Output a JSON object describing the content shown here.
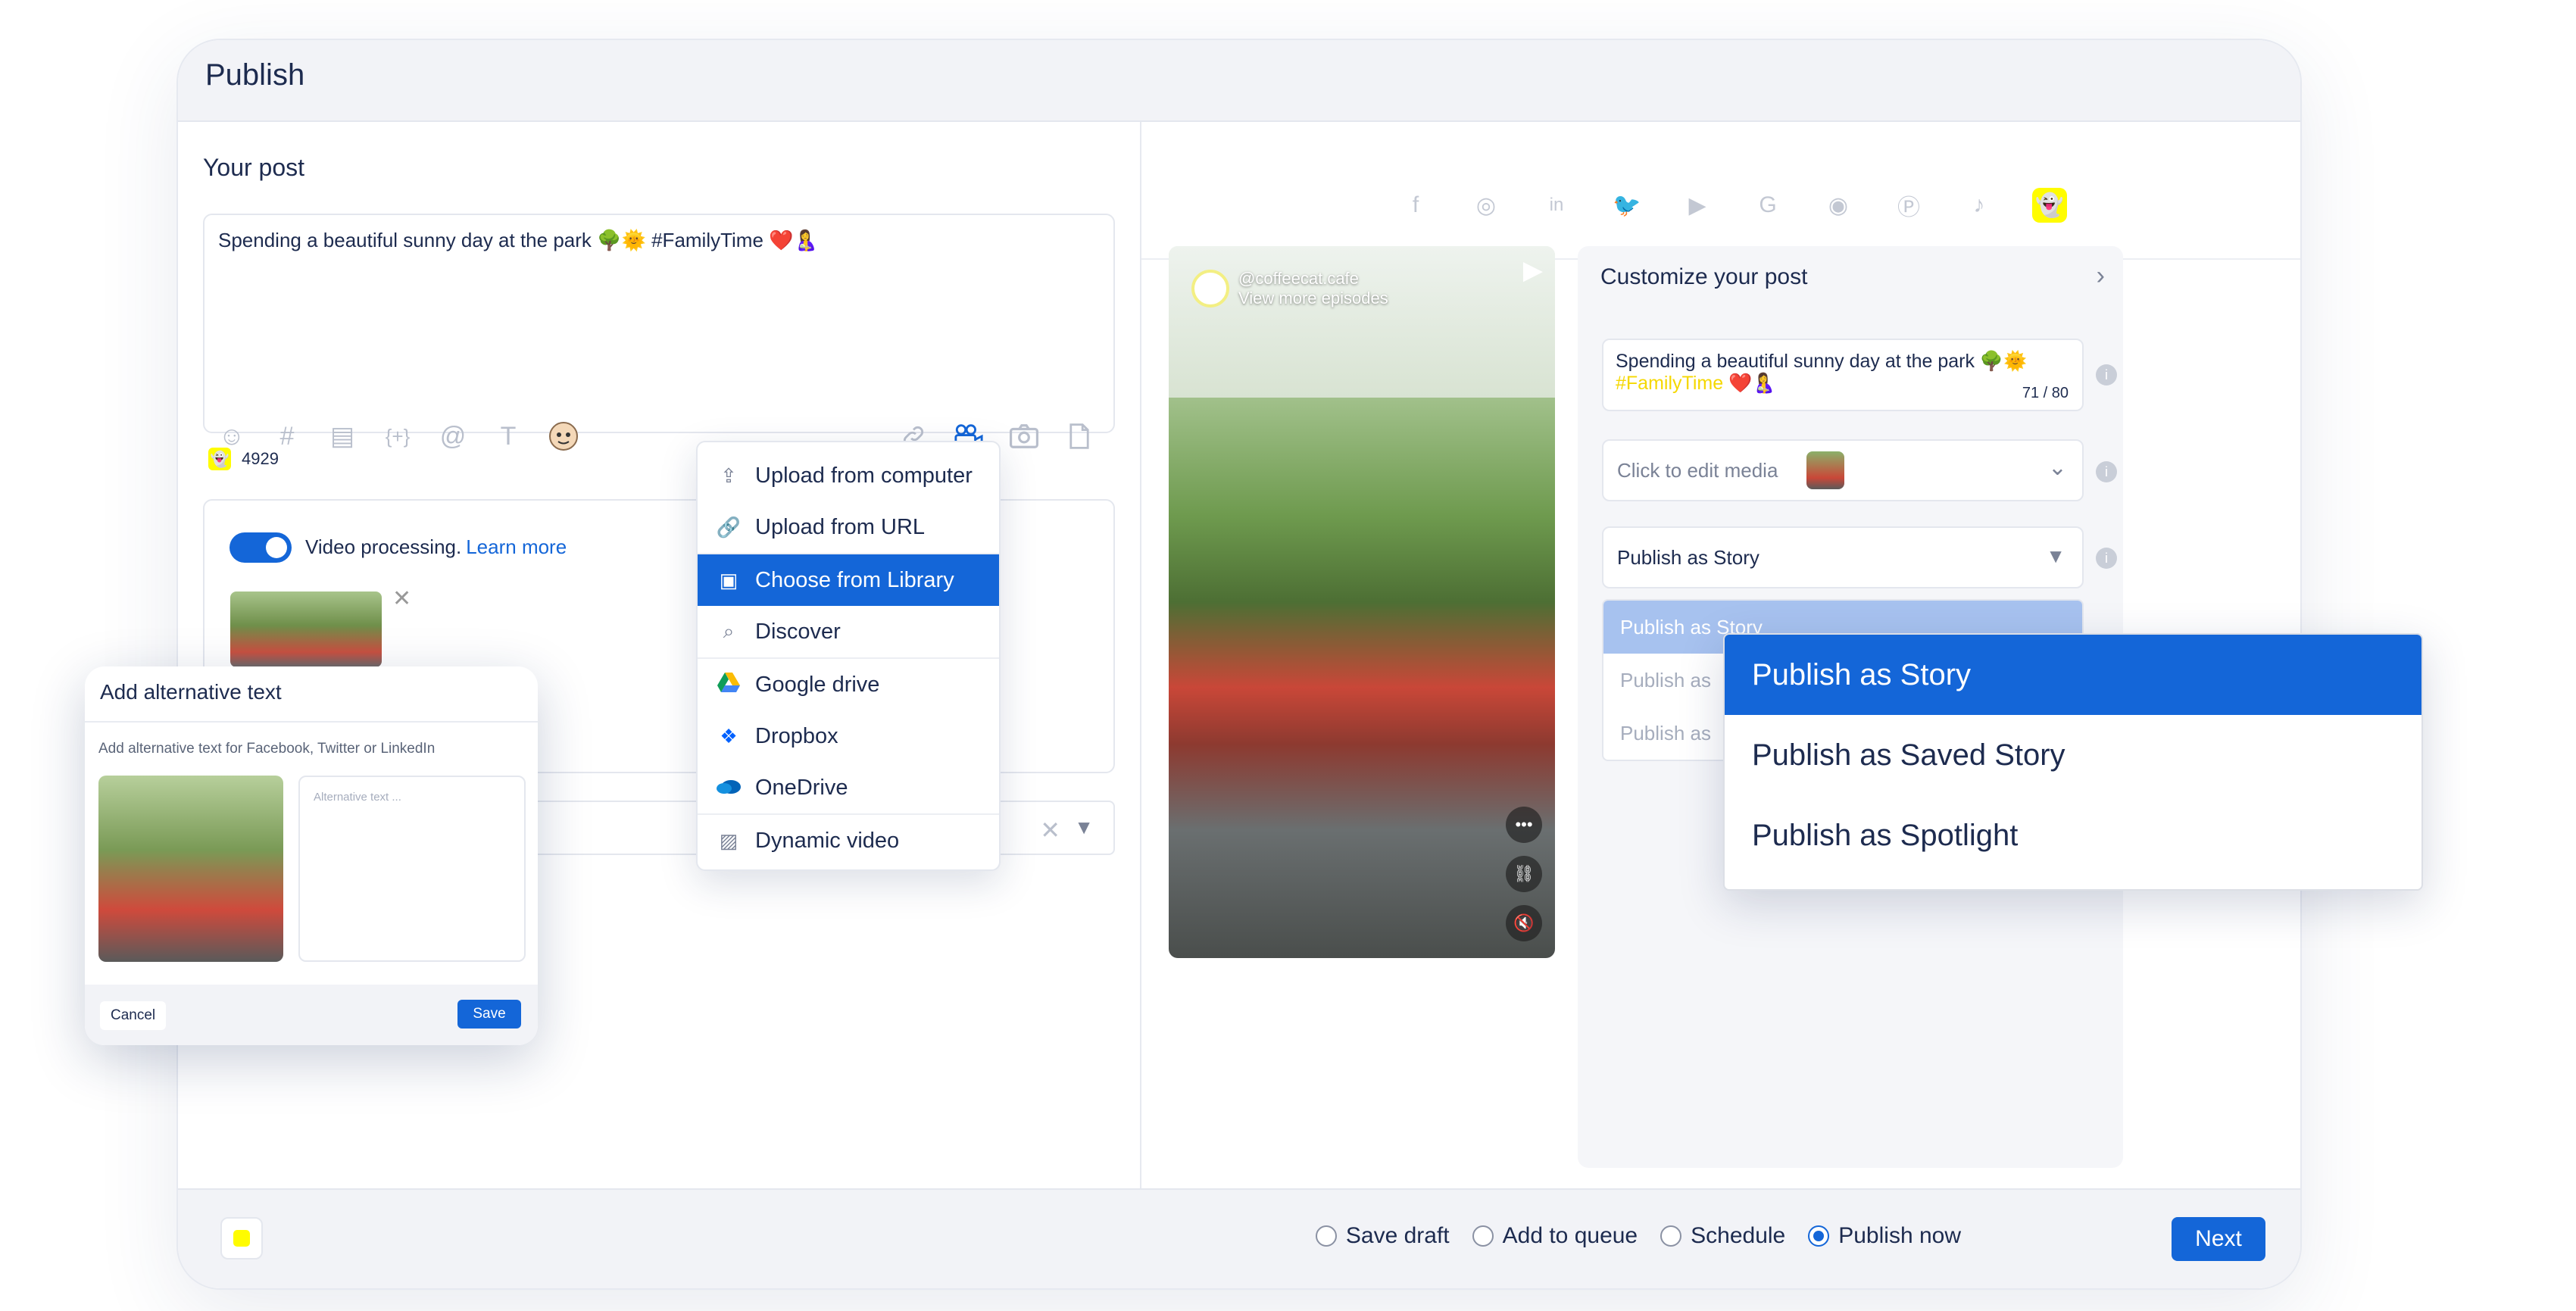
{
  "app": {
    "title": "Publish"
  },
  "post": {
    "section_title": "Your post",
    "text": "Spending a beautiful sunny day at the park 🌳🌞 #FamilyTime ❤️🤱",
    "char_count": "4929",
    "toolbar_icons": [
      "emoji-icon",
      "hashtag-icon",
      "layout-icon",
      "variable-icon",
      "mention-icon",
      "text-format-icon",
      "avatar-sticker-icon",
      "link-icon",
      "video-icon",
      "camera-icon",
      "document-icon"
    ],
    "video_processing_label": "Video processing.",
    "learn_more": "Learn more"
  },
  "upload_menu": {
    "items": [
      {
        "label": "Upload from computer",
        "icon": "upload-icon"
      },
      {
        "label": "Upload from URL",
        "icon": "link-icon"
      },
      {
        "label": "Choose from Library",
        "icon": "image-library-icon",
        "active": true
      },
      {
        "label": "Discover",
        "icon": "search-icon"
      },
      {
        "label": "Google drive",
        "icon": "google-drive-icon"
      },
      {
        "label": "Dropbox",
        "icon": "dropbox-icon"
      },
      {
        "label": "OneDrive",
        "icon": "onedrive-icon"
      },
      {
        "label": "Dynamic video",
        "icon": "dynamic-video-icon"
      }
    ]
  },
  "alt_dialog": {
    "title": "Add alternative text",
    "subtitle": "Add alternative text for Facebook, Twitter or LinkedIn",
    "placeholder": "Alternative text ...",
    "cancel": "Cancel",
    "save": "Save"
  },
  "networks": [
    "facebook-icon",
    "instagram-icon",
    "linkedin-icon",
    "twitter-icon",
    "youtube-icon",
    "google-icon",
    "reddit-icon",
    "pinterest-icon",
    "tiktok-icon",
    "snapchat-icon"
  ],
  "active_network": "snapchat-icon",
  "preview": {
    "handle": "@coffeecat.cafe",
    "subtext": "View more episodes"
  },
  "customize": {
    "title": "Customize your post",
    "caption_plain": "Spending a beautiful sunny day at the park 🌳🌞 ",
    "caption_hashtag": "#FamilyTime",
    "caption_tail": " ❤️🤱",
    "caption_count": "71 / 80",
    "media_label": "Click to edit media",
    "publish_select": "Publish as Story",
    "options_truncated": [
      "Publish as Story",
      "Publish as",
      "Publish as"
    ]
  },
  "publish_dropdown": {
    "options": [
      "Publish as Story",
      "Publish as Saved Story",
      "Publish as Spotlight"
    ],
    "selected": "Publish as Story"
  },
  "footer": {
    "radios": [
      {
        "label": "Save draft",
        "checked": false
      },
      {
        "label": "Add to queue",
        "checked": false
      },
      {
        "label": "Schedule",
        "checked": false
      },
      {
        "label": "Publish now",
        "checked": true
      }
    ],
    "next": "Next"
  },
  "colors": {
    "accent": "#1466d8",
    "snapchat": "#fffc00",
    "hashtag": "#f5d800"
  }
}
